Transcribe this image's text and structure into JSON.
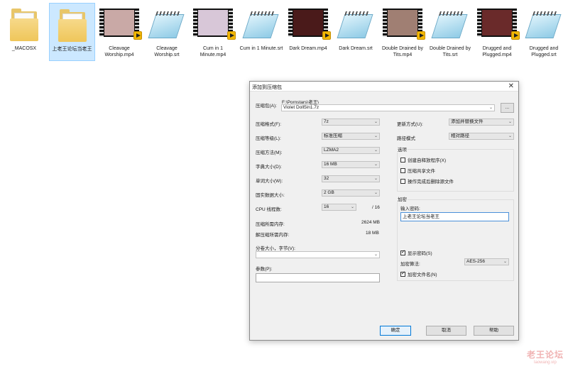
{
  "desktop": {
    "files": [
      {
        "name": "_MACOSX",
        "type": "folder",
        "selected": false
      },
      {
        "name": "上老王论坛当老王",
        "type": "folder",
        "selected": true
      },
      {
        "name": "Cleavage Worship.mp4",
        "type": "video",
        "thumb_color": "#c9a9a6"
      },
      {
        "name": "Cleavage Worship.srt",
        "type": "notepad"
      },
      {
        "name": "Cum in 1 Minute.mp4",
        "type": "video",
        "thumb_color": "#d8c7d8"
      },
      {
        "name": "Cum in 1 Minute.srt",
        "type": "notepad"
      },
      {
        "name": "Dark Dream.mp4",
        "type": "video",
        "thumb_color": "#4a1a1a"
      },
      {
        "name": "Dark Dream.srt",
        "type": "notepad"
      },
      {
        "name": "Double Drained by Tits.mp4",
        "type": "video",
        "thumb_color": "#a07f73"
      },
      {
        "name": "Double Drained by Tits.srt",
        "type": "notepad"
      },
      {
        "name": "Drugged and Plugged.mp4",
        "type": "video",
        "thumb_color": "#6a2a2a"
      },
      {
        "name": "Drugged and Plugged.srt",
        "type": "notepad"
      }
    ]
  },
  "dialog": {
    "title": "添加到压缩包",
    "archive_label": "压缩包(A):",
    "archive_path": "F:\\Pornstars\\老王\\",
    "archive_name": "Violet Doll5in1.7z",
    "browse_label": "...",
    "format_label": "压缩格式(F):",
    "format_value": "7z",
    "level_label": "压缩等级(L):",
    "level_value": "标准压缩",
    "method_label": "压缩方法(M):",
    "method_value": "LZMA2",
    "dict_label": "字典大小(D):",
    "dict_value": "16 MB",
    "word_label": "单词大小(W):",
    "word_value": "32",
    "solid_label": "固实数据大小:",
    "solid_value": "2 GB",
    "cpu_label": "CPU 线程数:",
    "cpu_value": "16",
    "cpu_total": "/ 16",
    "mem_comp_label": "压缩所需内存:",
    "mem_comp_value": "2624 MB",
    "mem_decomp_label": "解压缩所需内存:",
    "mem_decomp_value": "18 MB",
    "split_label": "分卷大小，字节(V):",
    "split_value": "",
    "params_label": "参数(P):",
    "params_value": "",
    "update_label": "更新方式(U):",
    "update_value": "添加并替换文件",
    "path_label": "路径模式",
    "path_value": "相对路径",
    "options_title": "选项",
    "opt_sfx": "创建自释放程序(X)",
    "opt_shared": "压缩共享文件",
    "opt_delete": "操作完成后删除源文件",
    "encrypt_title": "加密",
    "password_label": "输入密码:",
    "password_value": "上老王论坛当老王",
    "show_password": "显示密码(S)",
    "enc_method_label": "加密算法:",
    "enc_method_value": "AES-256",
    "encrypt_names": "加密文件名(N)",
    "ok": "确定",
    "cancel": "取消",
    "help": "帮助"
  },
  "watermark": {
    "line1": "老王论坛",
    "line2": "laowang.vip"
  }
}
